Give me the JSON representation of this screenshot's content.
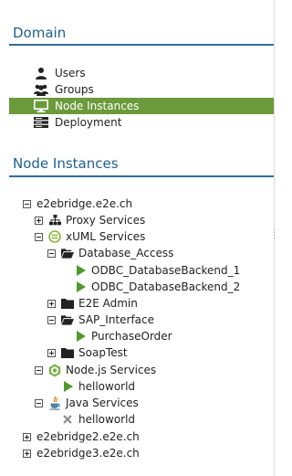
{
  "domain_panel": {
    "title": "Domain",
    "items": [
      {
        "label": "Users",
        "icon": "user-icon",
        "selected": false
      },
      {
        "label": "Groups",
        "icon": "group-icon",
        "selected": false
      },
      {
        "label": "Node Instances",
        "icon": "monitor-icon",
        "selected": true
      },
      {
        "label": "Deployment",
        "icon": "deployment-icon",
        "selected": false
      }
    ]
  },
  "nodes_panel": {
    "title": "Node Instances",
    "tree": [
      {
        "label": "e2ebridge.e2e.ch",
        "toggle": "minus",
        "icon": null
      },
      {
        "label": "Proxy Services",
        "toggle": "plus",
        "icon": "hierarchy-icon"
      },
      {
        "label": "xUML Services",
        "toggle": "minus",
        "icon": "xuml-icon"
      },
      {
        "label": "Database_Access",
        "toggle": "minus",
        "icon": "folder-open-icon"
      },
      {
        "label": "ODBC_DatabaseBackend_1",
        "toggle": null,
        "icon": "play-icon"
      },
      {
        "label": "ODBC_DatabaseBackend_2",
        "toggle": null,
        "icon": "play-icon"
      },
      {
        "label": "E2E Admin",
        "toggle": "plus",
        "icon": "folder-icon"
      },
      {
        "label": "SAP_Interface",
        "toggle": "minus",
        "icon": "folder-open-icon"
      },
      {
        "label": "PurchaseOrder",
        "toggle": null,
        "icon": "play-icon"
      },
      {
        "label": "SoapTest",
        "toggle": "plus",
        "icon": "folder-icon"
      },
      {
        "label": "Node.js Services",
        "toggle": "minus",
        "icon": "nodejs-icon"
      },
      {
        "label": "helloworld",
        "toggle": null,
        "icon": "play-icon"
      },
      {
        "label": "Java Services",
        "toggle": "minus",
        "icon": "java-icon"
      },
      {
        "label": "helloworld",
        "toggle": null,
        "icon": "stopped-x-icon"
      },
      {
        "label": "e2ebridge2.e2e.ch",
        "toggle": "plus",
        "icon": null
      },
      {
        "label": "e2ebridge3.e2e.ch",
        "toggle": "plus",
        "icon": null
      }
    ]
  },
  "colors": {
    "title": "#1d5f8f",
    "selected_bg": "#6b9a3b",
    "play": "#4f9a2c",
    "xuml": "#8ab43a",
    "nodejs": "#7bb24a"
  }
}
